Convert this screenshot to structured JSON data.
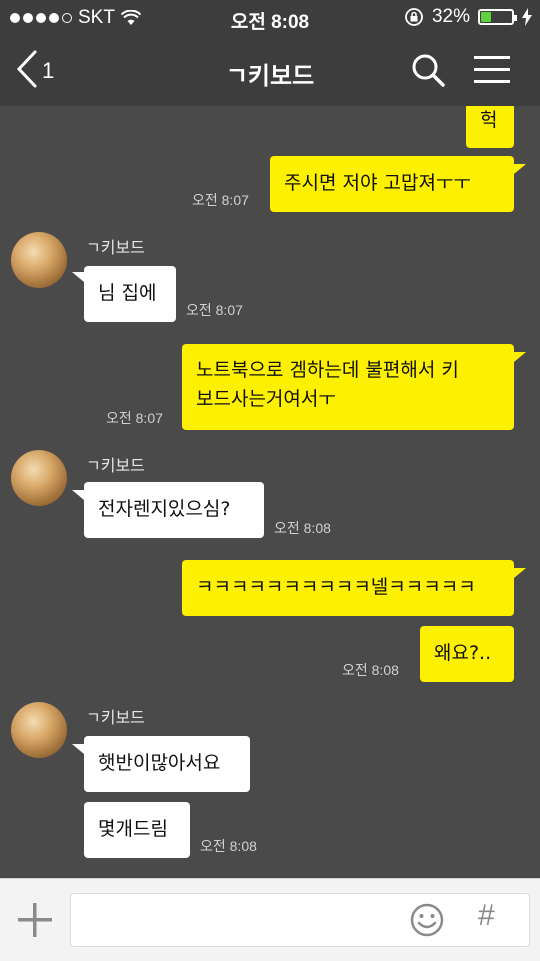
{
  "status_bar": {
    "carrier": "SKT",
    "time": "오전 8:08",
    "battery_percent": "32%",
    "battery_level": 0.32
  },
  "header": {
    "back_count": "1",
    "title": "ㄱ키보드"
  },
  "messages": {
    "m1": {
      "text": "헉"
    },
    "m2": {
      "text": "주시면 저야 고맙져ㅜㅜ",
      "time": "오전 8:07"
    },
    "g1": {
      "sender": "ㄱ키보드"
    },
    "m3": {
      "text": "님 집에",
      "time": "오전 8:07"
    },
    "m4": {
      "text": "노트북으로 겜하는데 불편해서 키\n보드사는거여서ㅜ",
      "time": "오전 8:07"
    },
    "g2": {
      "sender": "ㄱ키보드"
    },
    "m5": {
      "text": "전자렌지있으심?",
      "time": "오전 8:08"
    },
    "m6": {
      "text": "ㅋㅋㅋㅋㅋㅋㅋㅋㅋㅋ넬ㅋㅋㅋㅋㅋ"
    },
    "m7": {
      "text": "왜요?..",
      "time": "오전 8:08"
    },
    "g3": {
      "sender": "ㄱ키보드"
    },
    "m8": {
      "text": "햇반이많아서요"
    },
    "m9": {
      "text": "몇개드림",
      "time": "오전 8:08"
    }
  },
  "input_bar": {
    "hash_label": "#"
  },
  "colors": {
    "background": "#4a4a4a",
    "bar": "#3d3d3d",
    "outgoing_bubble": "#fdf000",
    "incoming_bubble": "#ffffff"
  }
}
